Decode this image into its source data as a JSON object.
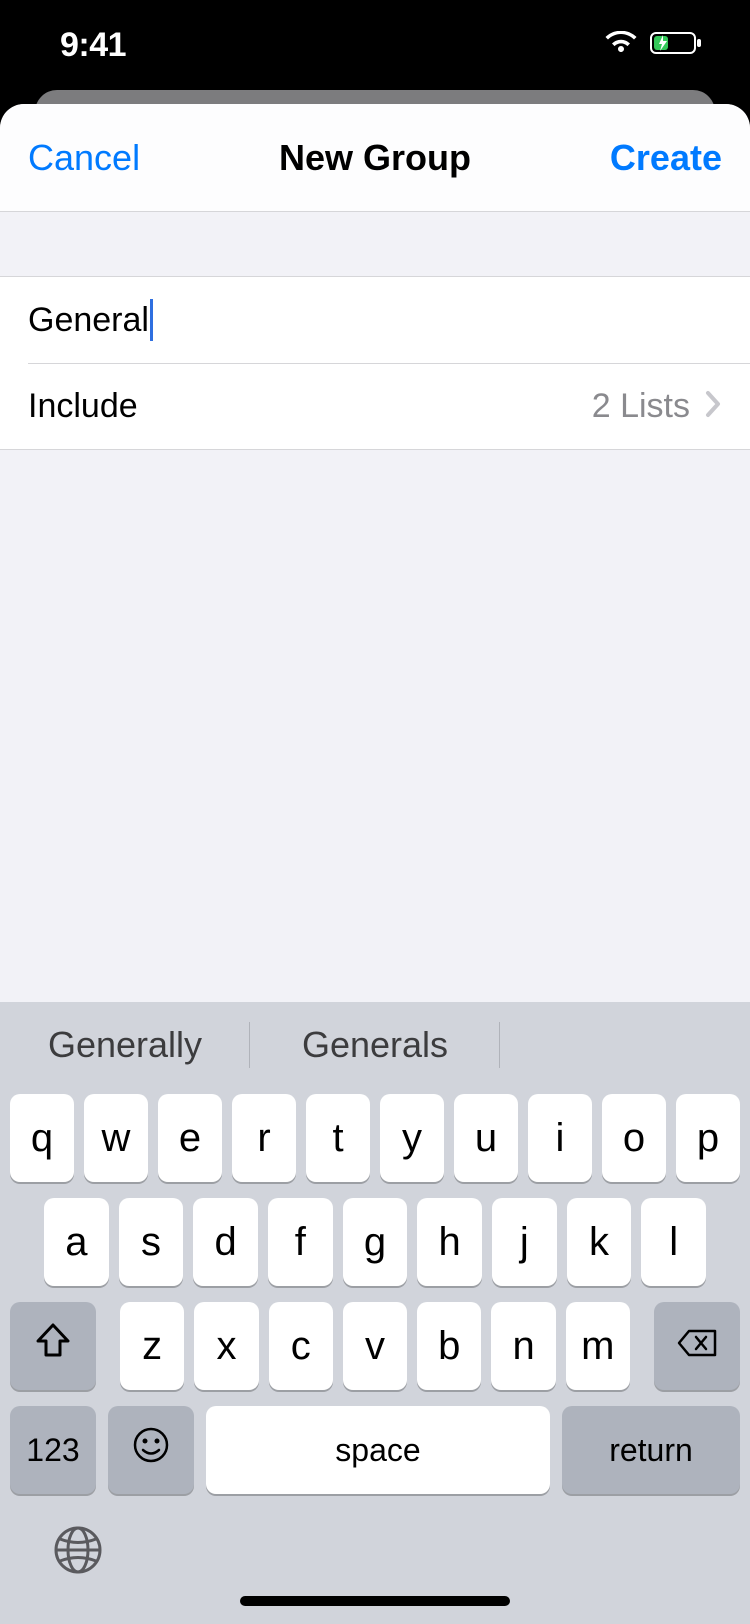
{
  "status": {
    "time": "9:41"
  },
  "nav": {
    "cancel": "Cancel",
    "title": "New Group",
    "create": "Create"
  },
  "form": {
    "name_value": "General",
    "include_label": "Include",
    "include_value": "2 Lists"
  },
  "keyboard": {
    "candidates": [
      "Generally",
      "Generals",
      ""
    ],
    "row1": [
      "q",
      "w",
      "e",
      "r",
      "t",
      "y",
      "u",
      "i",
      "o",
      "p"
    ],
    "row2": [
      "a",
      "s",
      "d",
      "f",
      "g",
      "h",
      "j",
      "k",
      "l"
    ],
    "row3": [
      "z",
      "x",
      "c",
      "v",
      "b",
      "n",
      "m"
    ],
    "num": "123",
    "space": "space",
    "return": "return"
  }
}
